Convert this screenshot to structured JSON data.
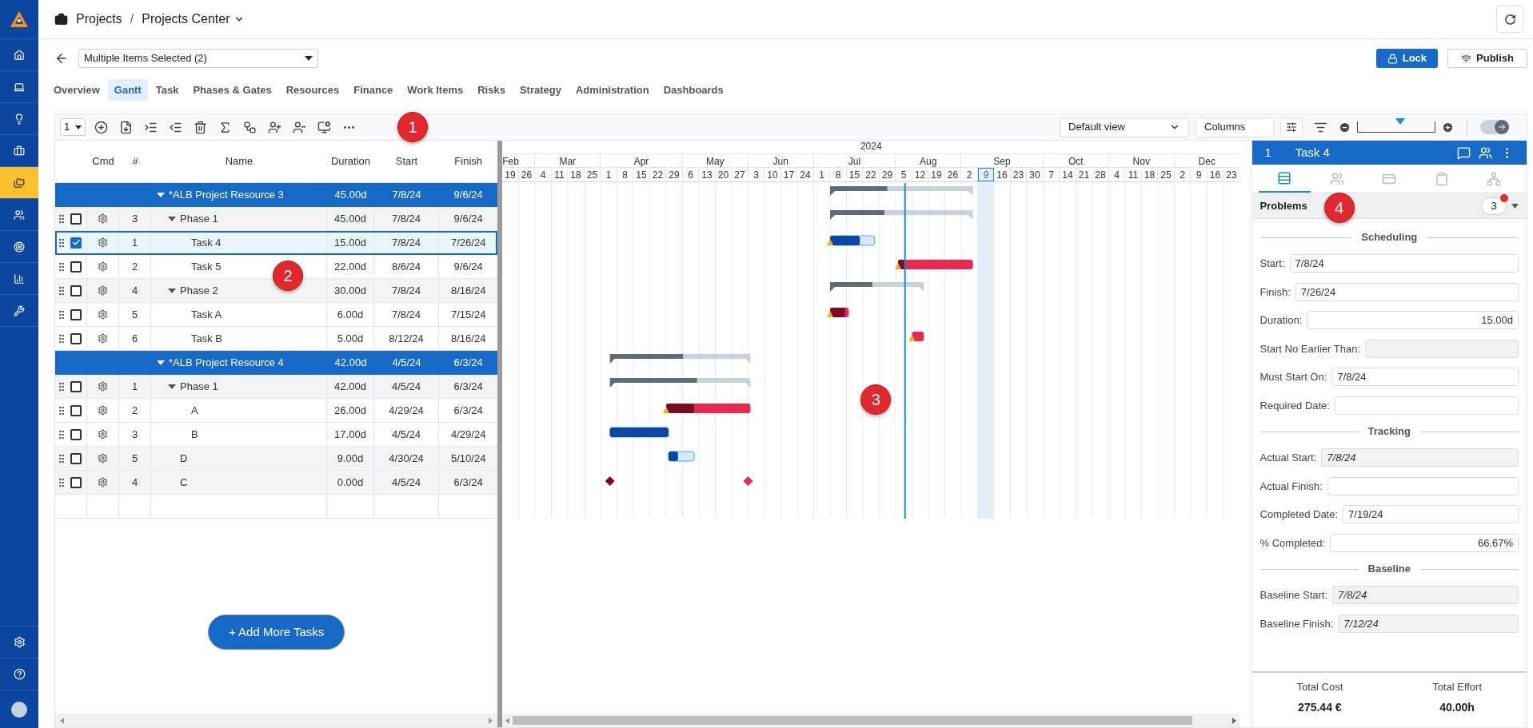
{
  "nav": {
    "items": [
      {
        "selected": false
      },
      {
        "selected": false
      },
      {
        "selected": false
      },
      {
        "selected": false
      },
      {
        "selected": true
      },
      {
        "selected": false
      },
      {
        "selected": false
      },
      {
        "selected": false
      },
      {
        "selected": false
      }
    ]
  },
  "breadcrumb": {
    "section": "Projects",
    "separator": "/",
    "page": "Projects Center"
  },
  "selector": {
    "value": "Multiple Items Selected (2)"
  },
  "actions": [
    {
      "label": "Lock",
      "kind": "primary"
    },
    {
      "label": "Publish",
      "kind": "secondary"
    }
  ],
  "tabs": [
    {
      "label": "Overview",
      "selected": false
    },
    {
      "label": "Gantt",
      "selected": true
    },
    {
      "label": "Task",
      "selected": false
    },
    {
      "label": "Phases & Gates",
      "selected": false
    },
    {
      "label": "Resources",
      "selected": false
    },
    {
      "label": "Finance",
      "selected": false
    },
    {
      "label": "Work Items",
      "selected": false
    },
    {
      "label": "Risks",
      "selected": false
    },
    {
      "label": "Strategy",
      "selected": false
    },
    {
      "label": "Administration",
      "selected": false
    },
    {
      "label": "Dashboards",
      "selected": false
    }
  ],
  "toolbar": {
    "level_select": "1",
    "callout": "1",
    "view": "Default view",
    "columns": "Columns",
    "zoom": {
      "level": 0.55
    },
    "toggle": {
      "on": true
    }
  },
  "grid": {
    "callout": "2",
    "columns": [
      "Cmd",
      "#",
      "Name",
      "Duration",
      "Start",
      "Finish"
    ],
    "rows": [
      {
        "kind": "summary",
        "name": "*ALB Project Resource 3",
        "duration": "45.00d",
        "start": "7/8/24",
        "finish": "9/6/24",
        "selected": false,
        "expanded": true,
        "level": 0.4,
        "children": [
          {
            "kind": "phase",
            "num": "3",
            "name": "Phase 1",
            "duration": "45.00d",
            "start": "7/8/24",
            "finish": "9/6/24",
            "checked": false,
            "selected": false,
            "expanded": true,
            "level": 0.38,
            "children": [
              {
                "kind": "task",
                "num": "1",
                "name": "Task 4",
                "duration": "15.00d",
                "start": "7/8/24",
                "finish": "7/26/24",
                "checked": true,
                "selected": true,
                "critical": false,
                "warning": true,
                "level": 0.67
              },
              {
                "kind": "task",
                "num": "2",
                "name": "Task 5",
                "duration": "22.00d",
                "start": "8/6/24",
                "finish": "9/6/24",
                "checked": false,
                "selected": false,
                "critical": true,
                "warning": true,
                "level": 0.1
              }
            ]
          },
          {
            "kind": "phase",
            "num": "4",
            "name": "Phase 2",
            "duration": "30.00d",
            "start": "7/8/24",
            "finish": "8/16/24",
            "checked": false,
            "selected": false,
            "expanded": true,
            "level": 0.45,
            "children": [
              {
                "kind": "task",
                "num": "5",
                "name": "Task A",
                "duration": "6.00d",
                "start": "7/8/24",
                "finish": "7/15/24",
                "checked": false,
                "selected": false,
                "critical": true,
                "warning": true,
                "level": 0.8
              },
              {
                "kind": "task",
                "num": "6",
                "name": "Task B",
                "duration": "5.00d",
                "start": "8/12/24",
                "finish": "8/16/24",
                "checked": false,
                "selected": false,
                "critical": true,
                "warning": true,
                "level": 0.0
              }
            ]
          }
        ]
      },
      {
        "kind": "summary",
        "name": "*ALB Project Resource 4",
        "duration": "42.00d",
        "start": "4/5/24",
        "finish": "6/3/24",
        "selected": false,
        "expanded": true,
        "level": 0.52,
        "children": [
          {
            "kind": "phase",
            "num": "1",
            "name": "Phase 1",
            "duration": "42.00d",
            "start": "4/5/24",
            "finish": "6/3/24",
            "checked": false,
            "selected": false,
            "expanded": true,
            "level": 0.62,
            "children": [
              {
                "kind": "task",
                "num": "2",
                "name": "A",
                "duration": "26.00d",
                "start": "4/29/24",
                "finish": "6/3/24",
                "checked": false,
                "selected": false,
                "critical": true,
                "warning": true,
                "level": 0.33
              },
              {
                "kind": "task",
                "num": "3",
                "name": "B",
                "duration": "17.00d",
                "start": "4/5/24",
                "finish": "4/29/24",
                "checked": false,
                "selected": false,
                "critical": false,
                "warning": false,
                "level": 1
              }
            ]
          },
          {
            "kind": "task",
            "num": "5",
            "name": "D",
            "duration": "9.00d",
            "start": "4/30/24",
            "finish": "5/10/24",
            "checked": false,
            "selected": false,
            "critical": false,
            "warning": false,
            "level": 0.37
          },
          {
            "kind": "milestone",
            "num": "4",
            "name": "C",
            "duration": "0.00d",
            "start": "4/5/24",
            "finish": "6/3/24",
            "checked": false,
            "selected": false
          }
        ]
      }
    ]
  },
  "add_button": "+ Add More Tasks",
  "timeline": {
    "year": "2024",
    "callout": "3",
    "months": [
      {
        "label": "Feb",
        "weeks": [
          {
            "label": "19",
            "selected": false
          },
          {
            "label": "26",
            "selected": false
          }
        ]
      },
      {
        "label": "Mar",
        "weeks": [
          {
            "label": "4",
            "selected": false
          },
          {
            "label": "11",
            "selected": false
          },
          {
            "label": "18",
            "selected": false
          },
          {
            "label": "25",
            "selected": false
          }
        ]
      },
      {
        "label": "Apr",
        "weeks": [
          {
            "label": "1",
            "selected": false
          },
          {
            "label": "8",
            "selected": false
          },
          {
            "label": "15",
            "selected": false
          },
          {
            "label": "22",
            "selected": false
          },
          {
            "label": "29",
            "selected": false
          }
        ]
      },
      {
        "label": "May",
        "weeks": [
          {
            "label": "6",
            "selected": false
          },
          {
            "label": "13",
            "selected": false
          },
          {
            "label": "20",
            "selected": false
          },
          {
            "label": "27",
            "selected": false
          }
        ]
      },
      {
        "label": "Jun",
        "weeks": [
          {
            "label": "3",
            "selected": false
          },
          {
            "label": "10",
            "selected": false
          },
          {
            "label": "17",
            "selected": false
          },
          {
            "label": "24",
            "selected": false
          }
        ]
      },
      {
        "label": "Jul",
        "weeks": [
          {
            "label": "1",
            "selected": false
          },
          {
            "label": "8",
            "selected": false
          },
          {
            "label": "15",
            "selected": false
          },
          {
            "label": "22",
            "selected": false
          },
          {
            "label": "29",
            "selected": false
          }
        ]
      },
      {
        "label": "Aug",
        "weeks": [
          {
            "label": "5",
            "selected": false
          },
          {
            "label": "12",
            "selected": false
          },
          {
            "label": "19",
            "selected": false
          },
          {
            "label": "26",
            "selected": false
          }
        ]
      },
      {
        "label": "Sep",
        "weeks": [
          {
            "label": "2",
            "selected": false
          },
          {
            "label": "9",
            "selected": true
          },
          {
            "label": "16",
            "selected": false
          },
          {
            "label": "23",
            "selected": false
          },
          {
            "label": "30",
            "selected": false
          }
        ]
      },
      {
        "label": "Oct",
        "weeks": [
          {
            "label": "7",
            "selected": false
          },
          {
            "label": "14",
            "selected": false
          },
          {
            "label": "21",
            "selected": false
          },
          {
            "label": "28",
            "selected": false
          }
        ]
      },
      {
        "label": "Nov",
        "weeks": [
          {
            "label": "4",
            "selected": false
          },
          {
            "label": "11",
            "selected": false
          },
          {
            "label": "18",
            "selected": false
          },
          {
            "label": "25",
            "selected": false
          }
        ]
      },
      {
        "label": "Dec",
        "weeks": [
          {
            "label": "2",
            "selected": false
          },
          {
            "label": "9",
            "selected": false
          },
          {
            "label": "16",
            "selected": false
          },
          {
            "label": "23",
            "selected": false
          }
        ]
      }
    ]
  },
  "detail": {
    "num": "1",
    "title": "Task 4",
    "tabs": [
      {
        "selected": true
      },
      {
        "selected": false
      },
      {
        "selected": false
      },
      {
        "selected": false
      },
      {
        "selected": false
      }
    ],
    "problems": {
      "label": "Problems",
      "count": "3",
      "alert": true
    },
    "callout": "4",
    "sections": [
      {
        "title": "Scheduling",
        "fields": [
          {
            "label": "Start:",
            "value": "7/8/24",
            "kind": "date"
          },
          {
            "label": "Finish:",
            "value": "7/26/24",
            "kind": "date"
          },
          {
            "label": "Duration:",
            "value": "15.00d",
            "kind": "number"
          },
          {
            "label": "Start No Earlier Than:",
            "kind": "locked"
          },
          {
            "label": "Must Start On:",
            "value": "7/8/24",
            "kind": "date"
          },
          {
            "label": "Required Date:",
            "kind": "date"
          }
        ]
      },
      {
        "title": "Tracking",
        "fields": [
          {
            "label": "Actual Start:",
            "value": "7/8/24",
            "kind": "locked"
          },
          {
            "label": "Actual Finish:",
            "kind": "date"
          },
          {
            "label": "Completed Date:",
            "value": "7/19/24",
            "kind": "date"
          },
          {
            "label": "% Completed:",
            "value": "66.67%",
            "kind": "number"
          }
        ]
      },
      {
        "title": "Baseline",
        "fields": [
          {
            "label": "Baseline Start:",
            "value": "7/8/24",
            "kind": "locked"
          },
          {
            "label": "Baseline Finish:",
            "value": "7/12/24",
            "kind": "locked"
          }
        ]
      }
    ],
    "totals": [
      {
        "label": "Total Cost",
        "value": "275.44 €"
      },
      {
        "label": "Total Effort",
        "value": "40.00h"
      }
    ]
  }
}
